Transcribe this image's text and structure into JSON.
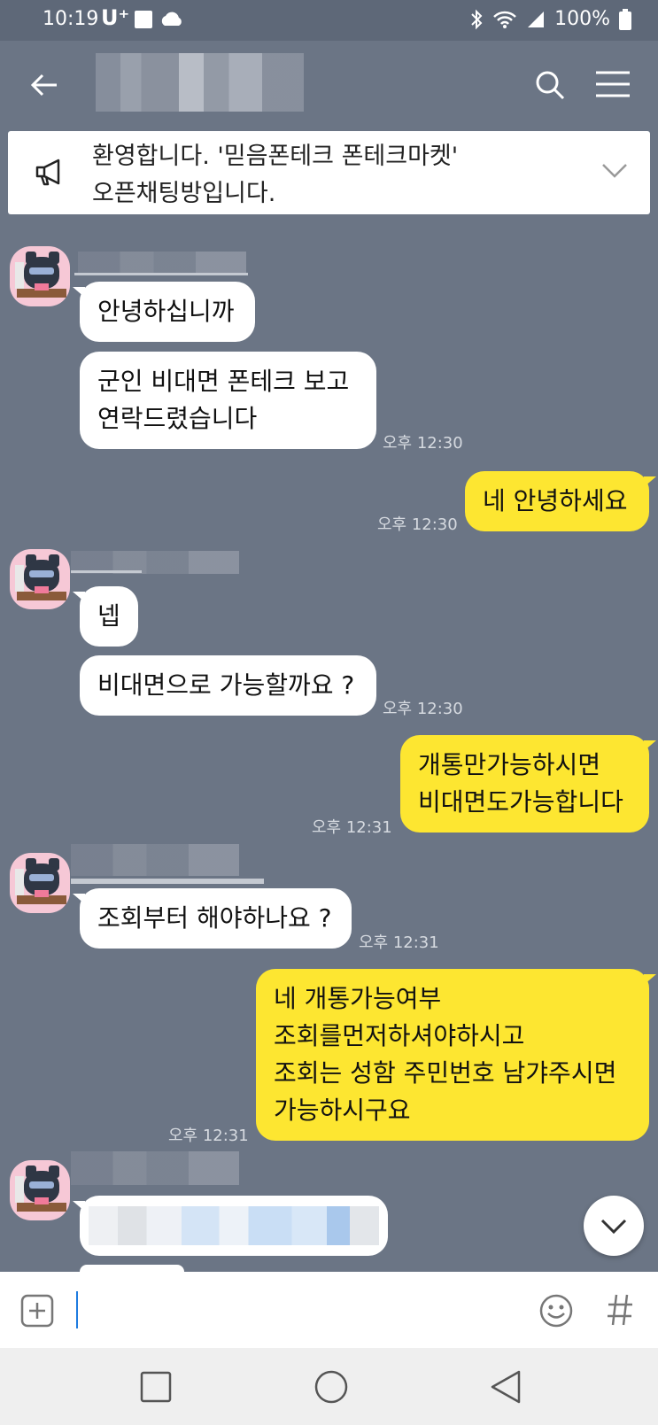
{
  "status": {
    "time": "10:19",
    "carrier": "U⁺",
    "battery": "100%"
  },
  "notice": {
    "line1": "환영합니다. '믿음폰테크 폰테크마켓'",
    "line2": "오픈채팅방입니다."
  },
  "messages": {
    "m1": "안녕하십니까",
    "m2_l1": "군인 비대면 폰테크 보고",
    "m2_l2": "연락드렸습니다",
    "t1": "오후 12:30",
    "m3": "네 안녕하세요",
    "t2": "오후 12:30",
    "m4": "넵",
    "m5": "비대면으로 가능할까요 ?",
    "t3": "오후 12:30",
    "m6_l1": "개통만가능하시면",
    "m6_l2": "비대면도가능합니다",
    "t4": "오후 12:31",
    "m7": "조회부터 해야하나요 ?",
    "t5": "오후 12:31",
    "m8_l1": "네 개통가능여부",
    "m8_l2": "조회를먼저하셔야하시고",
    "m8_l3": "조회는 성함 주민번호 남갸주시면",
    "m8_l4": "가능하시구요",
    "t6": "오후 12:31"
  },
  "icons": {
    "back": "arrow-left",
    "search": "search",
    "menu": "hamburger",
    "notice": "megaphone",
    "expand": "chevron-down",
    "scroll": "chevron-down",
    "add": "plus-square",
    "emoji": "smiley",
    "hashtag": "#",
    "nav_recent": "square",
    "nav_home": "circle",
    "nav_back": "triangle"
  },
  "colors": {
    "background": "#6b7585",
    "my_bubble": "#fde631",
    "other_bubble": "#ffffff"
  }
}
